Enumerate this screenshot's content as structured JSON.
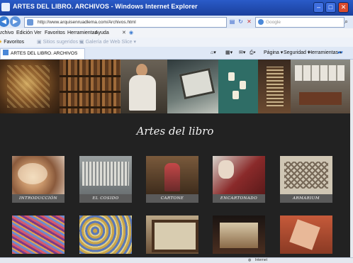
{
  "window": {
    "title": "ARTES DEL LIBRO. ARCHIVOS - Windows Internet Explorer",
    "min": "–",
    "max": "□",
    "close": "✕"
  },
  "address_bar": {
    "url": "http://www.arquisenruadlema.com/Archivos.html",
    "search_placeholder": "Google",
    "icons": [
      "back-icon",
      "forward-icon",
      "refresh-icon",
      "stop-icon"
    ]
  },
  "menu": [
    "Archivo",
    "Edición",
    "Ver",
    "Favoritos",
    "Herramientas",
    "Ayuda"
  ],
  "favorites_bar": {
    "label": "Favoritos",
    "items": [
      "Sitios sugeridos",
      "Galería de Web Slice"
    ]
  },
  "tab": {
    "label": "ARTES DEL LIBRO. ARCHIVOS"
  },
  "command_bar": [
    "Página",
    "Seguridad",
    "Herramientas"
  ],
  "page": {
    "heading": "Artes del libro",
    "tiles_row1": [
      "INTRODUCCIÓN",
      "EL COSIDO",
      "CARTONE",
      "ENCARTONADO",
      "ARMARIUM"
    ],
    "tiles_row2": [
      "",
      "",
      "",
      "",
      ""
    ]
  },
  "status": {
    "zone": "Internet"
  },
  "colors": {
    "page_bg": "#222222",
    "caption_bg": "#5a5a5a",
    "title_bar": "#1a3f9c"
  }
}
